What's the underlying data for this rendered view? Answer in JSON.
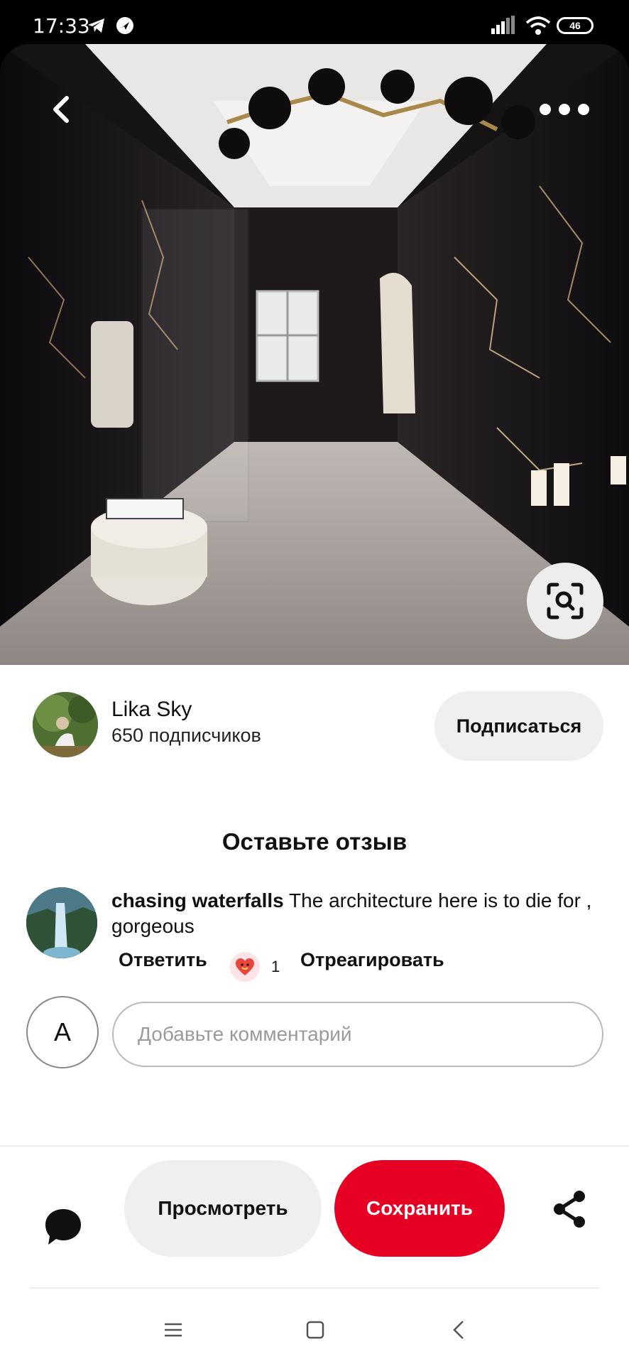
{
  "status_bar": {
    "time": "17:33",
    "battery": "46",
    "icons": [
      "telegram-icon",
      "notification-icon",
      "signal-icon",
      "wifi-icon",
      "battery-icon"
    ]
  },
  "pin": {
    "icons": [
      "back-icon",
      "more-icon",
      "visual-search-icon"
    ]
  },
  "author": {
    "name": "Lika Sky",
    "followers": "650 подписчиков",
    "follow_label": "Подписаться"
  },
  "reviews": {
    "title": "Оставьте отзыв",
    "comment": {
      "author": "chasing waterfalls",
      "text": " The architecture here is to die for , gorgeous",
      "reply_label": "Ответить",
      "reaction_count": "1",
      "react_label": "Отреагировать"
    },
    "user_initial": "A",
    "input_placeholder": "Добавьте комментарий"
  },
  "actions": {
    "view_label": "Просмотреть",
    "save_label": "Сохранить",
    "colors": {
      "save": "#e60023",
      "view": "#efefef"
    }
  },
  "system_nav": [
    "menu-icon",
    "home-icon",
    "back-nav-icon"
  ]
}
